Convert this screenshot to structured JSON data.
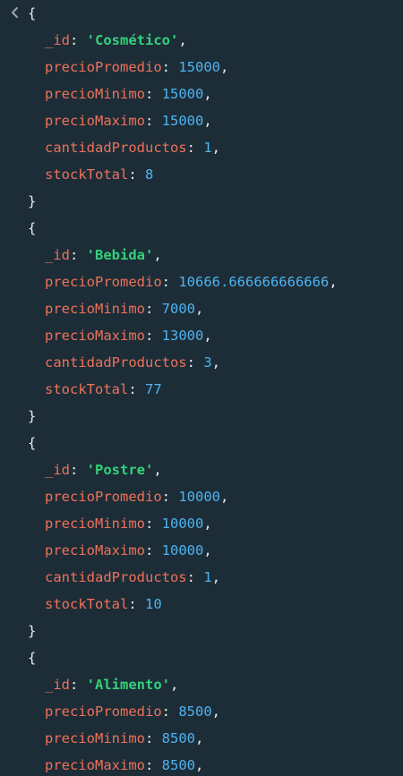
{
  "colors": {
    "background": "#1c2d38",
    "key": "#ef7159",
    "number": "#4fb3ef",
    "string": "#33d17a",
    "punctuation": "#e8edf0"
  },
  "icons": {
    "expander": "chevron-left-icon"
  },
  "punctuation": {
    "open_brace": "{",
    "close_brace": "}",
    "colon": ": ",
    "comma": ","
  },
  "documents": [
    {
      "id_key": "_id",
      "id_value": "'Cosmético'",
      "fields": [
        {
          "key": "precioPromedio",
          "value": "15000",
          "comma": ","
        },
        {
          "key": "precioMinimo",
          "value": "15000",
          "comma": ","
        },
        {
          "key": "precioMaximo",
          "value": "15000",
          "comma": ","
        },
        {
          "key": "cantidadProductos",
          "value": "1",
          "comma": ","
        },
        {
          "key": "stockTotal",
          "value": "8",
          "comma": ""
        }
      ]
    },
    {
      "id_key": "_id",
      "id_value": "'Bebida'",
      "fields": [
        {
          "key": "precioPromedio",
          "value": "10666.666666666666",
          "comma": ","
        },
        {
          "key": "precioMinimo",
          "value": "7000",
          "comma": ","
        },
        {
          "key": "precioMaximo",
          "value": "13000",
          "comma": ","
        },
        {
          "key": "cantidadProductos",
          "value": "3",
          "comma": ","
        },
        {
          "key": "stockTotal",
          "value": "77",
          "comma": ""
        }
      ]
    },
    {
      "id_key": "_id",
      "id_value": "'Postre'",
      "fields": [
        {
          "key": "precioPromedio",
          "value": "10000",
          "comma": ","
        },
        {
          "key": "precioMinimo",
          "value": "10000",
          "comma": ","
        },
        {
          "key": "precioMaximo",
          "value": "10000",
          "comma": ","
        },
        {
          "key": "cantidadProductos",
          "value": "1",
          "comma": ","
        },
        {
          "key": "stockTotal",
          "value": "10",
          "comma": ""
        }
      ]
    },
    {
      "id_key": "_id",
      "id_value": "'Alimento'",
      "fields": [
        {
          "key": "precioPromedio",
          "value": "8500",
          "comma": ","
        },
        {
          "key": "precioMinimo",
          "value": "8500",
          "comma": ","
        },
        {
          "key": "precioMaximo",
          "value": "8500",
          "comma": ","
        }
      ]
    }
  ]
}
